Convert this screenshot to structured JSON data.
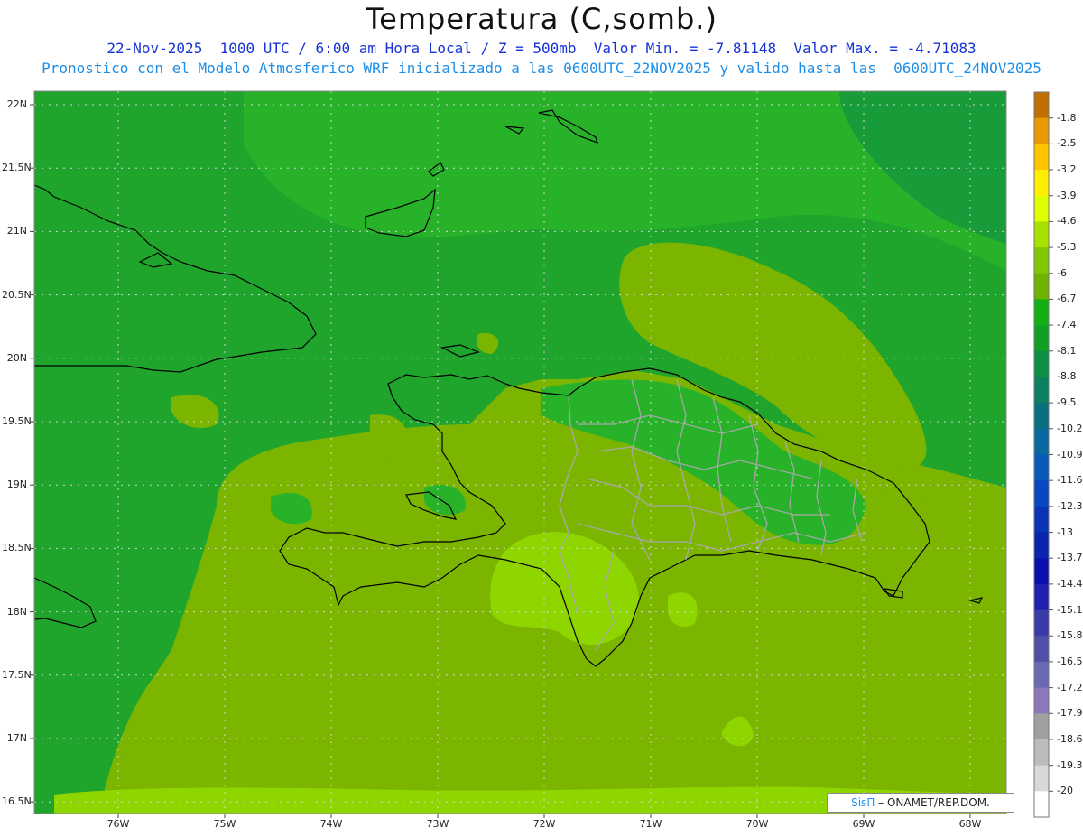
{
  "header": {
    "title": "Temperatura (C,somb.)",
    "subtitle_line1": "22-Nov-2025  1000 UTC / 6:00 am Hora Local / Z = 500mb  Valor Min. = -7.81148  Valor Max. = -4.71083",
    "subtitle_line2": "Pronostico con el Modelo Atmosferico WRF inicializado a las 0600UTC_22NOV2025 y valido hasta las  0600UTC_24NOV2025"
  },
  "axes": {
    "lat_labels": [
      "22N",
      "21.5N",
      "21N",
      "20.5N",
      "20N",
      "19.5N",
      "19N",
      "18.5N",
      "18N",
      "17.5N",
      "17N",
      "16.5N"
    ],
    "lon_labels": [
      "76W",
      "75W",
      "74W",
      "73W",
      "72W",
      "71W",
      "70W",
      "69W",
      "68W"
    ]
  },
  "colorbar": {
    "labels": [
      "-1.8",
      "-2.5",
      "-3.2",
      "-3.9",
      "-4.6",
      "-5.3",
      "-6",
      "-6.7",
      "-7.4",
      "-8.1",
      "-8.8",
      "-9.5",
      "-10.2",
      "-10.9",
      "-11.6",
      "-12.3",
      "-13",
      "-13.7",
      "-14.4",
      "-15.1",
      "-15.8",
      "-16.5",
      "-17.2",
      "-17.9",
      "-18.6",
      "-19.3",
      "-20"
    ],
    "colors": [
      "#c07000",
      "#e89a00",
      "#ffc400",
      "#ffee00",
      "#ddff00",
      "#a8e000",
      "#80c800",
      "#6fb200",
      "#12b012",
      "#10a024",
      "#0e9044",
      "#0c8060",
      "#0a7080",
      "#0a68a0",
      "#0a5ab8",
      "#0a48c0",
      "#0a34b8",
      "#0a24b0",
      "#0a10b0",
      "#2020b0",
      "#3a3aa8",
      "#5050a8",
      "#6a6ab4",
      "#8a78b8",
      "#a0a0a0",
      "#bcbcbc",
      "#d8d8d8",
      "#ffffff"
    ]
  },
  "credit": {
    "sis": "SisΠ",
    "text": " – ONAMET/REP.DOM."
  },
  "palette": {
    "dark_green": "#1fa42c",
    "mid_green": "#27b22a",
    "olive": "#7cb500",
    "light_green": "#8fd600",
    "coast": "#000000",
    "provinces": "#a8a8a8"
  }
}
